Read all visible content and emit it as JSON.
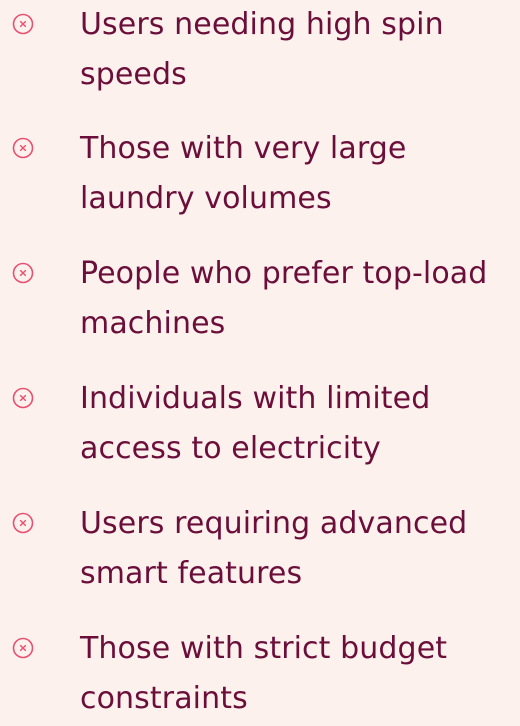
{
  "exclusions": {
    "icon": "circle-x-icon",
    "icon_color": "#e8506f",
    "text_color": "#6b0f3a",
    "background": "#fdf1ee",
    "items": [
      {
        "line1": "Users needing high spin",
        "line2": "speeds"
      },
      {
        "line1": "Those with very large",
        "line2": "laundry volumes"
      },
      {
        "line1": "People who prefer top-load",
        "line2": "machines"
      },
      {
        "line1": "Individuals with limited",
        "line2": "access to electricity"
      },
      {
        "line1": "Users requiring advanced",
        "line2": "smart features"
      },
      {
        "line1": "Those with strict budget",
        "line2": "constraints"
      }
    ]
  }
}
